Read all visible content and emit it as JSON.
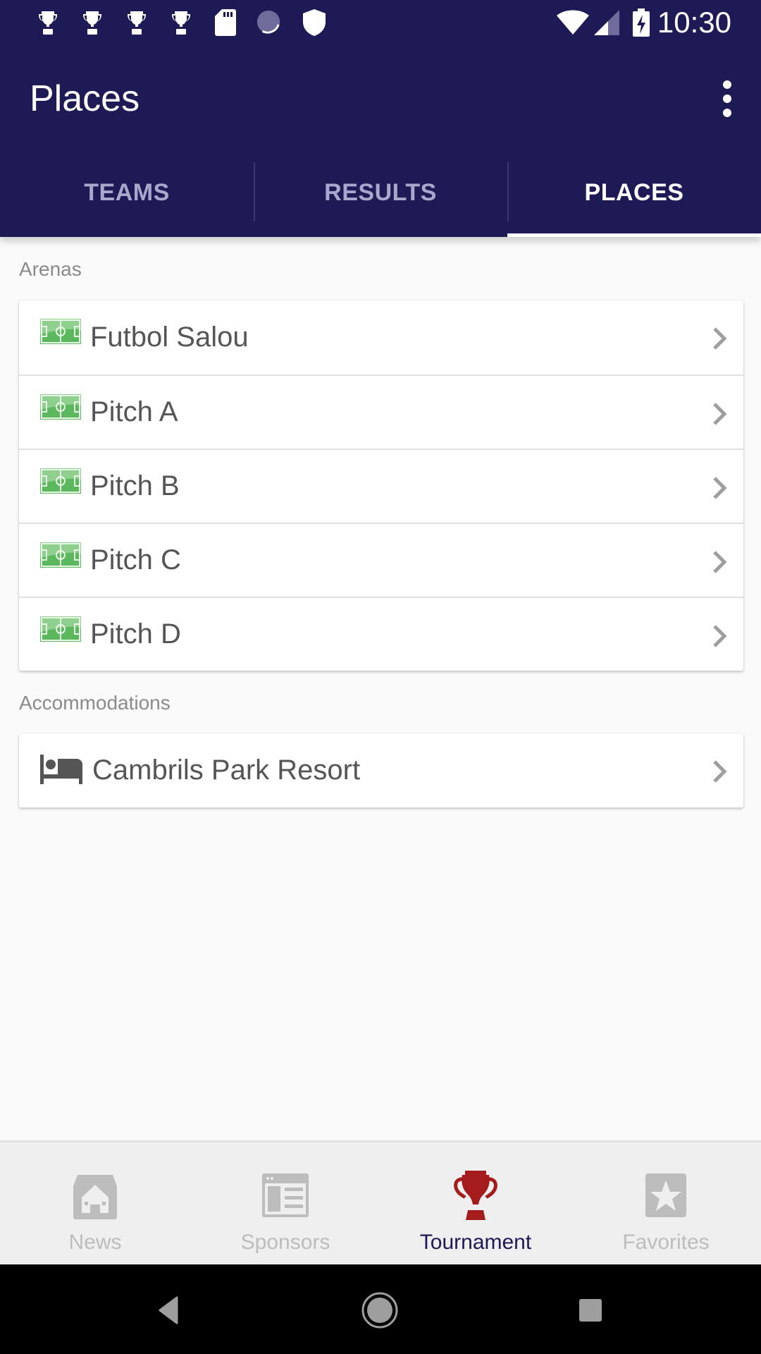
{
  "status_bar": {
    "time": "10:30",
    "left_icons": [
      "trophy-icon",
      "trophy-icon",
      "trophy-icon",
      "trophy-icon",
      "sd-card-icon",
      "sync-icon",
      "shield-icon"
    ],
    "right_icons": [
      "wifi-icon",
      "signal-icon",
      "battery-charging-icon"
    ]
  },
  "toolbar": {
    "title": "Places",
    "overflow_icon": "more-vert-icon"
  },
  "tabs": [
    {
      "label": "TEAMS",
      "active": false
    },
    {
      "label": "RESULTS",
      "active": false
    },
    {
      "label": "PLACES",
      "active": true
    }
  ],
  "sections": {
    "arenas": {
      "title": "Arenas",
      "items": [
        {
          "label": "Futbol Salou",
          "icon": "soccer-field-icon"
        },
        {
          "label": "Pitch A",
          "icon": "soccer-field-icon"
        },
        {
          "label": "Pitch B",
          "icon": "soccer-field-icon"
        },
        {
          "label": "Pitch C",
          "icon": "soccer-field-icon"
        },
        {
          "label": "Pitch D",
          "icon": "soccer-field-icon"
        }
      ]
    },
    "accommodations": {
      "title": "Accommodations",
      "items": [
        {
          "label": "Cambrils Park Resort",
          "icon": "bed-icon"
        }
      ]
    }
  },
  "bottom_nav": [
    {
      "label": "News",
      "icon": "home-icon",
      "active": false
    },
    {
      "label": "Sponsors",
      "icon": "newspaper-icon",
      "active": false
    },
    {
      "label": "Tournament",
      "icon": "trophy-icon",
      "active": true
    },
    {
      "label": "Favorites",
      "icon": "star-icon",
      "active": false
    }
  ],
  "colors": {
    "primary": "#1e1a55",
    "accent": "#a51c1c",
    "inactive": "#bdbdbd"
  }
}
